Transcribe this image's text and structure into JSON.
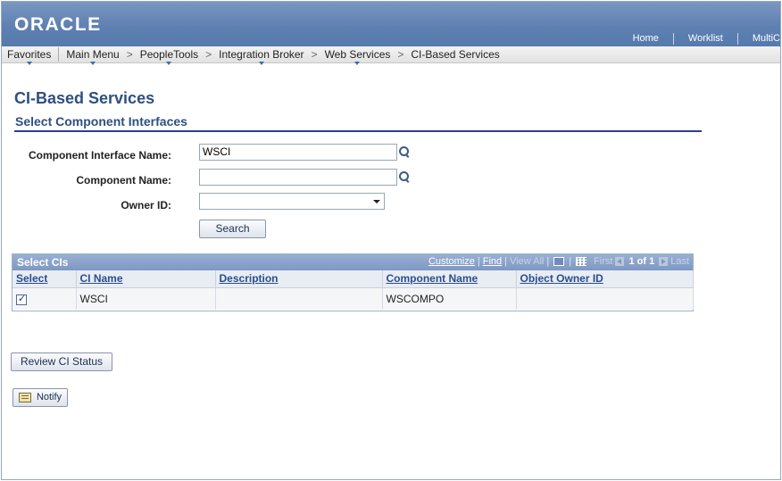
{
  "header": {
    "logo": "ORACLE",
    "links": [
      "Home",
      "Worklist",
      "MultiC"
    ]
  },
  "breadcrumb": {
    "favorites": "Favorites",
    "main_menu": "Main Menu",
    "peopletools": "PeopleTools",
    "integration_broker": "Integration Broker",
    "web_services": "Web Services",
    "current": "CI-Based Services",
    "separator": ">"
  },
  "page": {
    "title": "CI-Based Services",
    "subtitle": "Select Component Interfaces"
  },
  "form": {
    "ci_name_label": "Component Interface Name:",
    "ci_name_value": "WSCI",
    "component_name_label": "Component Name:",
    "component_name_value": "",
    "owner_id_label": "Owner ID:",
    "owner_id_value": "",
    "search_button": "Search"
  },
  "grid": {
    "title": "Select CIs",
    "customize": "Customize",
    "find": "Find",
    "view_all": "View All",
    "first": "First",
    "page_info": "1 of 1",
    "last": "Last",
    "columns": [
      "Select",
      "CI Name",
      "Description",
      "Component Name",
      "Object Owner ID"
    ],
    "rows": [
      {
        "selected": true,
        "ci_name": "WSCI",
        "description": "",
        "component_name": "WSCOMPO",
        "owner_id": ""
      }
    ]
  },
  "actions": {
    "review_button": "Review CI Status",
    "notify_button": "Notify"
  }
}
